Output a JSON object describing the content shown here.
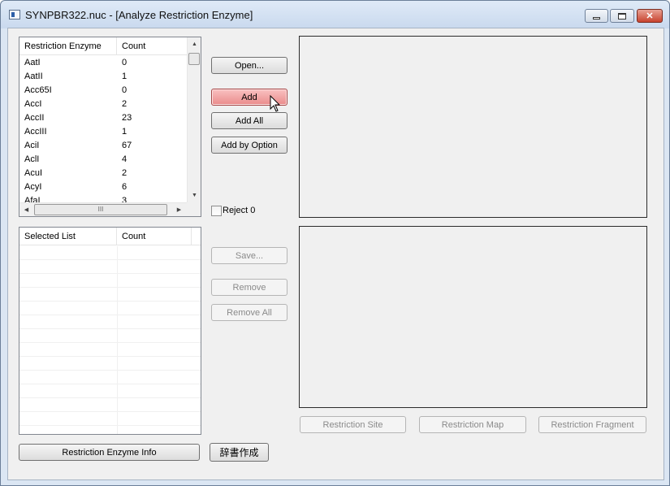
{
  "window": {
    "title": "SYNPBR322.nuc - [Analyze Restriction Enzyme]",
    "min_glyph": "",
    "max_glyph": "",
    "close_glyph": "✕"
  },
  "enzyme_list": {
    "headers": [
      "Restriction Enzyme",
      "Count"
    ],
    "rows": [
      {
        "name": "AatI",
        "count": "0"
      },
      {
        "name": "AatII",
        "count": "1"
      },
      {
        "name": "Acc65I",
        "count": "0"
      },
      {
        "name": "AccI",
        "count": "2"
      },
      {
        "name": "AccII",
        "count": "23"
      },
      {
        "name": "AccIII",
        "count": "1"
      },
      {
        "name": "AciI",
        "count": "67"
      },
      {
        "name": "AclI",
        "count": "4"
      },
      {
        "name": "AcuI",
        "count": "2"
      },
      {
        "name": "AcyI",
        "count": "6"
      },
      {
        "name": "AfaI",
        "count": "3"
      }
    ],
    "hscroll_thumb_glyph": "III"
  },
  "selected_list": {
    "headers": [
      "Selected List",
      "Count"
    ]
  },
  "buttons": {
    "open": "Open...",
    "add": "Add",
    "add_all": "Add All",
    "add_by_option": "Add by Option",
    "save": "Save...",
    "remove": "Remove",
    "remove_all": "Remove All",
    "restriction_site": "Restriction Site",
    "restriction_map": "Restriction Map",
    "restriction_fragment": "Restriction Fragment",
    "enzyme_info": "Restriction Enzyme Info",
    "dictionary": "辞書作成"
  },
  "reject_zero": {
    "label": "Reject 0",
    "checked": false
  },
  "colors": {
    "hot_button": "#ea8b8b",
    "titlebar": "#c9d9ee",
    "close_button": "#c9432e"
  }
}
